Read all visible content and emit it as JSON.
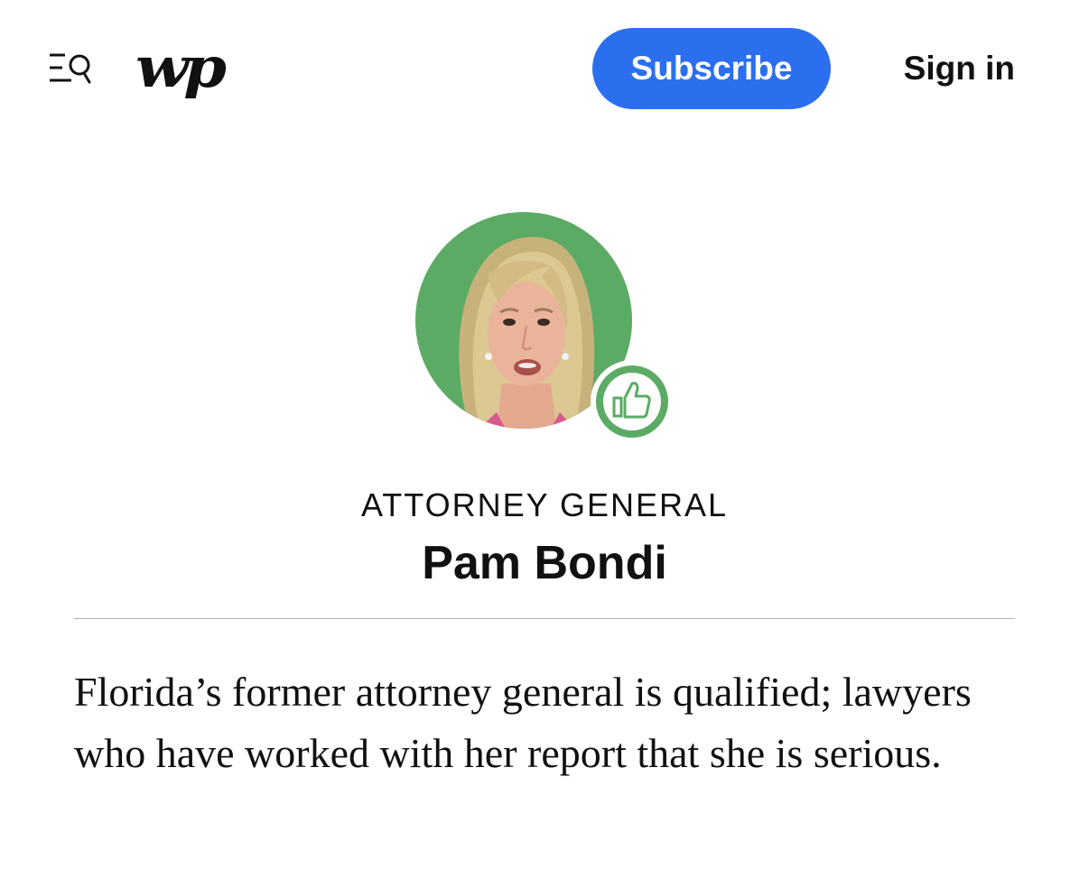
{
  "header": {
    "logo_text": "wp",
    "subscribe_label": "Subscribe",
    "signin_label": "Sign in",
    "brand_color": "#2b6fee"
  },
  "profile": {
    "role": "ATTORNEY GENERAL",
    "name": "Pam Bondi",
    "avatar_background": "#5bab64",
    "badge_icon": "thumbs-up-icon",
    "badge_color": "#5bab64"
  },
  "blurb": {
    "text": "Florida’s former attorney general is qualified; lawyers who have worked with her report that she is serious."
  }
}
